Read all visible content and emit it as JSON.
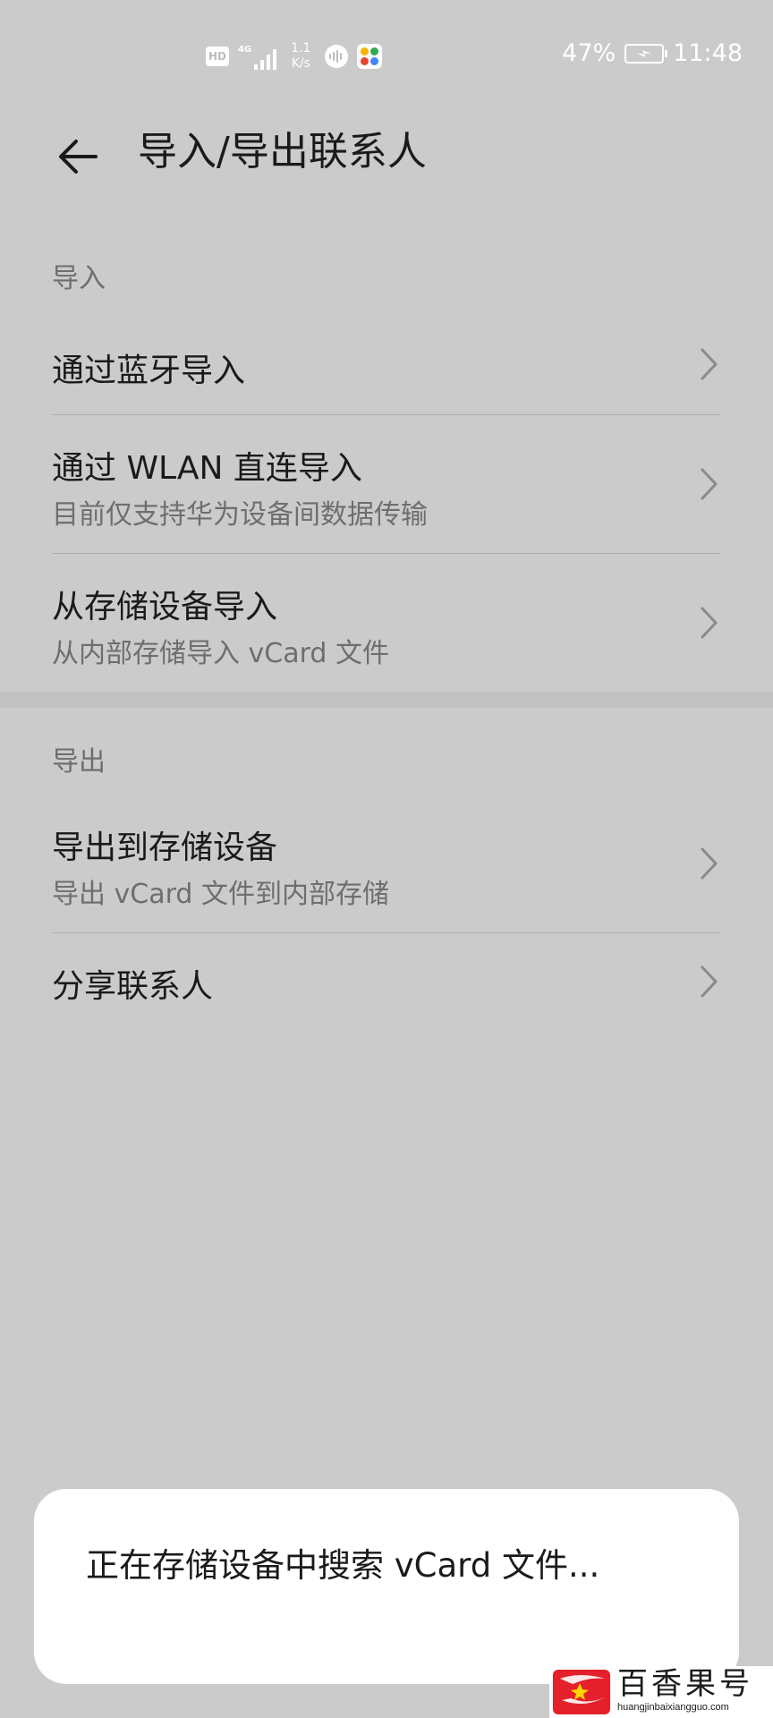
{
  "status_bar": {
    "hd": "HD",
    "network": "4G",
    "speed_value": "1.1",
    "speed_unit": "K/s",
    "battery": "47%",
    "time": "11:48",
    "icons": [
      "hd-icon",
      "signal-icon",
      "voice-assistant-icon",
      "app-notification-icon",
      "battery-charging-icon"
    ]
  },
  "app_bar": {
    "title": "导入/导出联系人",
    "back_icon": "arrow-left-icon"
  },
  "sections": {
    "import": {
      "header": "导入",
      "items": [
        {
          "title": "通过蓝牙导入",
          "subtitle": ""
        },
        {
          "title": "通过 WLAN 直连导入",
          "subtitle": "目前仅支持华为设备间数据传输"
        },
        {
          "title": "从存储设备导入",
          "subtitle": "从内部存储导入 vCard 文件"
        }
      ]
    },
    "export": {
      "header": "导出",
      "items": [
        {
          "title": "导出到存储设备",
          "subtitle": "导出 vCard 文件到内部存储"
        },
        {
          "title": "分享联系人",
          "subtitle": ""
        }
      ]
    }
  },
  "dialog": {
    "message": "正在存储设备中搜索 vCard 文件..."
  },
  "watermark": {
    "name": "百香果号",
    "url": "huangjinbaixiangguo.com"
  },
  "colors": {
    "background": "#cbcbcb",
    "dialog": "#ffffff",
    "text_primary": "#1a1a1a",
    "text_secondary": "#6e6e6e",
    "watermark_logo": "#e4202a"
  }
}
